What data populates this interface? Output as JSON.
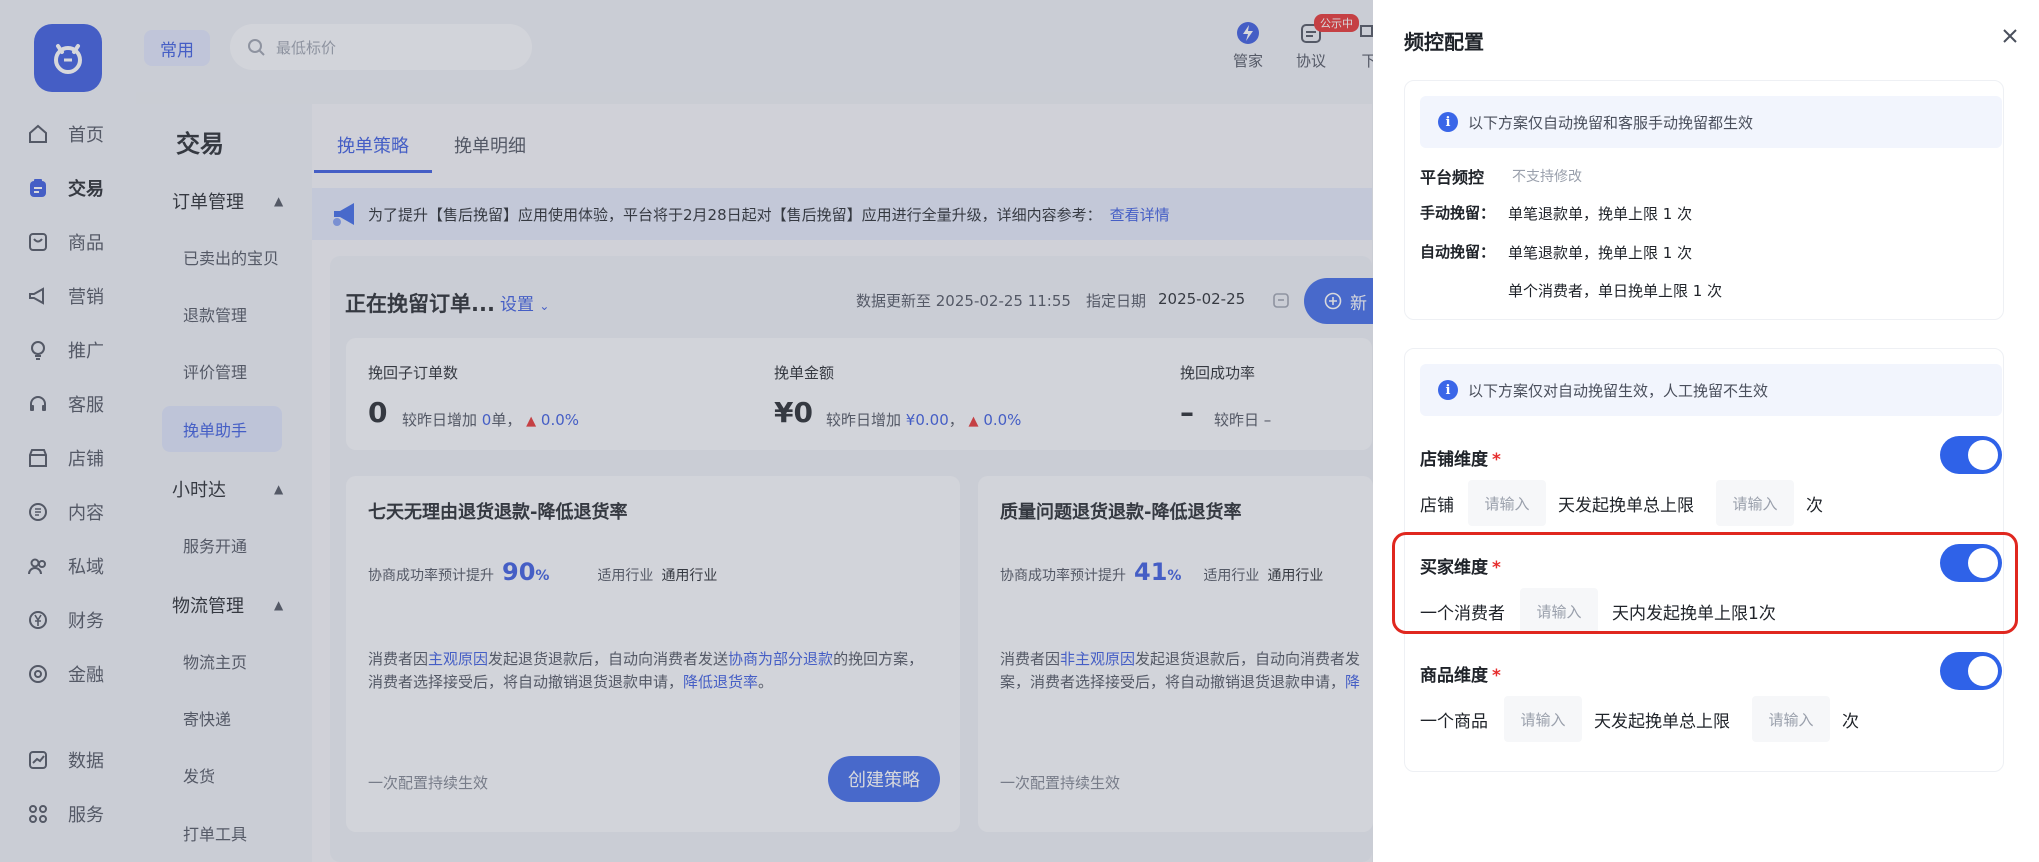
{
  "nav": {
    "items": [
      {
        "label": "首页",
        "icon": "home-icon"
      },
      {
        "label": "交易",
        "icon": "clipboard-icon"
      },
      {
        "label": "商品",
        "icon": "product-icon"
      },
      {
        "label": "营销",
        "icon": "megaphone-icon"
      },
      {
        "label": "推广",
        "icon": "bulb-icon"
      },
      {
        "label": "客服",
        "icon": "headset-icon"
      },
      {
        "label": "店铺",
        "icon": "store-icon"
      },
      {
        "label": "内容",
        "icon": "content-icon"
      },
      {
        "label": "私域",
        "icon": "people-icon"
      },
      {
        "label": "财务",
        "icon": "yen-icon"
      },
      {
        "label": "金融",
        "icon": "finance-icon"
      },
      {
        "label": "数据",
        "icon": "chart-icon"
      },
      {
        "label": "服务",
        "icon": "grid-icon"
      }
    ],
    "active": "交易"
  },
  "topbar": {
    "common_label": "常用",
    "search_placeholder": "最低标价",
    "icons": [
      {
        "label": "管家",
        "icon": "butler-icon"
      },
      {
        "label": "协议",
        "icon": "agreement-icon",
        "badge": "公示中"
      },
      {
        "label": "下",
        "icon": "download-icon"
      }
    ]
  },
  "subnav": {
    "title": "交易",
    "groups": [
      {
        "title": "订单管理",
        "items": [
          "已卖出的宝贝",
          "退款管理",
          "评价管理",
          "挽单助手"
        ]
      },
      {
        "title": "小时达",
        "items": [
          "服务开通"
        ]
      },
      {
        "title": "物流管理",
        "items": [
          "物流主页",
          "寄快递",
          "发货",
          "打单工具"
        ]
      }
    ],
    "active_item": "挽单助手"
  },
  "main": {
    "tabs": [
      "挽单策略",
      "挽单明细"
    ],
    "active_tab": "挽单策略",
    "notice": "为了提升【售后挽留】应用使用体验，平台将于2月28日起对【售后挽留】应用进行全量升级，详细内容参考：",
    "notice_link": "查看详情",
    "section_title": "正在挽留订单...",
    "setting_link": "设置",
    "update_text": "数据更新至 2025-02-25 11:55",
    "date_label": "指定日期",
    "date_value": "2025-02-25",
    "new_button": "新",
    "stats": [
      {
        "label": "挽回子订单数",
        "value": "0",
        "sub_prefix": "较昨日增加",
        "sub_value": "0",
        "sub_unit": "单，",
        "change": "0.0%"
      },
      {
        "label": "挽单金额",
        "value": "¥0",
        "sub_prefix": "较昨日增加",
        "sub_value": "¥0.00",
        "sub_unit": "，",
        "change": "0.0%"
      },
      {
        "label": "挽回成功率",
        "value": "–",
        "sub_prefix": "较昨日 –"
      }
    ],
    "cards": [
      {
        "title": "七天无理由退货退款-降低退货率",
        "meta_label": "协商成功率预计提升",
        "meta_pct": "90",
        "industry_label": "适用行业",
        "industry_value": "通用行业",
        "desc_parts": [
          "消费者因",
          "主观原因",
          "发起退货退款后，自动向消费者发送",
          "协商为部分退款",
          "的挽回方案，"
        ],
        "desc_line2_parts": [
          "消费者选择接受后，将自动撤销退货退款申请，",
          "降低退货率",
          "。"
        ],
        "foot": "一次配置持续生效",
        "button": "创建策略"
      },
      {
        "title": "质量问题退货退款-降低退货率",
        "meta_label": "协商成功率预计提升",
        "meta_pct": "41",
        "industry_label": "适用行业",
        "industry_value": "通用行业",
        "desc_parts": [
          "消费者因",
          "非主观原因",
          "发起退货退款后，自动向消费者发"
        ],
        "desc_line2_parts": [
          "案，消费者选择接受后，将自动撤销退货退款申请，",
          "降"
        ],
        "foot": "一次配置持续生效"
      }
    ],
    "pct_unit": "%"
  },
  "drawer": {
    "title": "频控配置",
    "info1": "以下方案仅自动挽留和客服手动挽留都生效",
    "platform_label": "平台频控",
    "platform_note": "不支持修改",
    "manual_label": "手动挽留：",
    "manual_value": "单笔退款单，挽单上限 1 次",
    "auto_label": "自动挽留：",
    "auto_value1": "单笔退款单，挽单上限 1 次",
    "auto_value2": "单个消费者，单日挽单上限 1 次",
    "info2": "以下方案仅对自动挽留生效，人工挽留不生效",
    "shop": {
      "label": "店铺维度",
      "prefix": "店铺",
      "middle": "天发起挽单总上限",
      "suffix": "次",
      "placeholder": "请输入",
      "enabled": true
    },
    "buyer": {
      "label": "买家维度",
      "prefix": "一个消费者",
      "middle": "天内发起挽单上限1次",
      "placeholder": "请输入",
      "enabled": true
    },
    "product": {
      "label": "商品维度",
      "prefix": "一个商品",
      "middle": "天发起挽单总上限",
      "suffix": "次",
      "placeholder": "请输入",
      "enabled": true
    },
    "required_mark": "*"
  }
}
